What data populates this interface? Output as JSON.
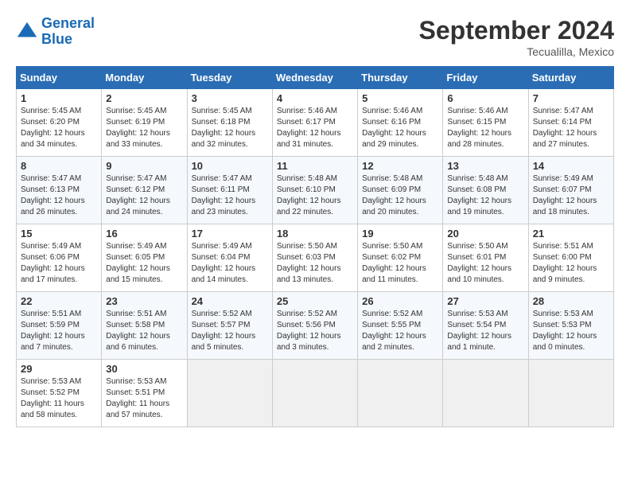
{
  "header": {
    "logo_line1": "General",
    "logo_line2": "Blue",
    "month": "September 2024",
    "location": "Tecualilla, Mexico"
  },
  "columns": [
    "Sunday",
    "Monday",
    "Tuesday",
    "Wednesday",
    "Thursday",
    "Friday",
    "Saturday"
  ],
  "weeks": [
    [
      {
        "day": "1",
        "info": "Sunrise: 5:45 AM\nSunset: 6:20 PM\nDaylight: 12 hours\nand 34 minutes."
      },
      {
        "day": "2",
        "info": "Sunrise: 5:45 AM\nSunset: 6:19 PM\nDaylight: 12 hours\nand 33 minutes."
      },
      {
        "day": "3",
        "info": "Sunrise: 5:45 AM\nSunset: 6:18 PM\nDaylight: 12 hours\nand 32 minutes."
      },
      {
        "day": "4",
        "info": "Sunrise: 5:46 AM\nSunset: 6:17 PM\nDaylight: 12 hours\nand 31 minutes."
      },
      {
        "day": "5",
        "info": "Sunrise: 5:46 AM\nSunset: 6:16 PM\nDaylight: 12 hours\nand 29 minutes."
      },
      {
        "day": "6",
        "info": "Sunrise: 5:46 AM\nSunset: 6:15 PM\nDaylight: 12 hours\nand 28 minutes."
      },
      {
        "day": "7",
        "info": "Sunrise: 5:47 AM\nSunset: 6:14 PM\nDaylight: 12 hours\nand 27 minutes."
      }
    ],
    [
      {
        "day": "8",
        "info": "Sunrise: 5:47 AM\nSunset: 6:13 PM\nDaylight: 12 hours\nand 26 minutes."
      },
      {
        "day": "9",
        "info": "Sunrise: 5:47 AM\nSunset: 6:12 PM\nDaylight: 12 hours\nand 24 minutes."
      },
      {
        "day": "10",
        "info": "Sunrise: 5:47 AM\nSunset: 6:11 PM\nDaylight: 12 hours\nand 23 minutes."
      },
      {
        "day": "11",
        "info": "Sunrise: 5:48 AM\nSunset: 6:10 PM\nDaylight: 12 hours\nand 22 minutes."
      },
      {
        "day": "12",
        "info": "Sunrise: 5:48 AM\nSunset: 6:09 PM\nDaylight: 12 hours\nand 20 minutes."
      },
      {
        "day": "13",
        "info": "Sunrise: 5:48 AM\nSunset: 6:08 PM\nDaylight: 12 hours\nand 19 minutes."
      },
      {
        "day": "14",
        "info": "Sunrise: 5:49 AM\nSunset: 6:07 PM\nDaylight: 12 hours\nand 18 minutes."
      }
    ],
    [
      {
        "day": "15",
        "info": "Sunrise: 5:49 AM\nSunset: 6:06 PM\nDaylight: 12 hours\nand 17 minutes."
      },
      {
        "day": "16",
        "info": "Sunrise: 5:49 AM\nSunset: 6:05 PM\nDaylight: 12 hours\nand 15 minutes."
      },
      {
        "day": "17",
        "info": "Sunrise: 5:49 AM\nSunset: 6:04 PM\nDaylight: 12 hours\nand 14 minutes."
      },
      {
        "day": "18",
        "info": "Sunrise: 5:50 AM\nSunset: 6:03 PM\nDaylight: 12 hours\nand 13 minutes."
      },
      {
        "day": "19",
        "info": "Sunrise: 5:50 AM\nSunset: 6:02 PM\nDaylight: 12 hours\nand 11 minutes."
      },
      {
        "day": "20",
        "info": "Sunrise: 5:50 AM\nSunset: 6:01 PM\nDaylight: 12 hours\nand 10 minutes."
      },
      {
        "day": "21",
        "info": "Sunrise: 5:51 AM\nSunset: 6:00 PM\nDaylight: 12 hours\nand 9 minutes."
      }
    ],
    [
      {
        "day": "22",
        "info": "Sunrise: 5:51 AM\nSunset: 5:59 PM\nDaylight: 12 hours\nand 7 minutes."
      },
      {
        "day": "23",
        "info": "Sunrise: 5:51 AM\nSunset: 5:58 PM\nDaylight: 12 hours\nand 6 minutes."
      },
      {
        "day": "24",
        "info": "Sunrise: 5:52 AM\nSunset: 5:57 PM\nDaylight: 12 hours\nand 5 minutes."
      },
      {
        "day": "25",
        "info": "Sunrise: 5:52 AM\nSunset: 5:56 PM\nDaylight: 12 hours\nand 3 minutes."
      },
      {
        "day": "26",
        "info": "Sunrise: 5:52 AM\nSunset: 5:55 PM\nDaylight: 12 hours\nand 2 minutes."
      },
      {
        "day": "27",
        "info": "Sunrise: 5:53 AM\nSunset: 5:54 PM\nDaylight: 12 hours\nand 1 minute."
      },
      {
        "day": "28",
        "info": "Sunrise: 5:53 AM\nSunset: 5:53 PM\nDaylight: 12 hours\nand 0 minutes."
      }
    ],
    [
      {
        "day": "29",
        "info": "Sunrise: 5:53 AM\nSunset: 5:52 PM\nDaylight: 11 hours\nand 58 minutes."
      },
      {
        "day": "30",
        "info": "Sunrise: 5:53 AM\nSunset: 5:51 PM\nDaylight: 11 hours\nand 57 minutes."
      },
      {
        "day": "",
        "info": ""
      },
      {
        "day": "",
        "info": ""
      },
      {
        "day": "",
        "info": ""
      },
      {
        "day": "",
        "info": ""
      },
      {
        "day": "",
        "info": ""
      }
    ]
  ]
}
